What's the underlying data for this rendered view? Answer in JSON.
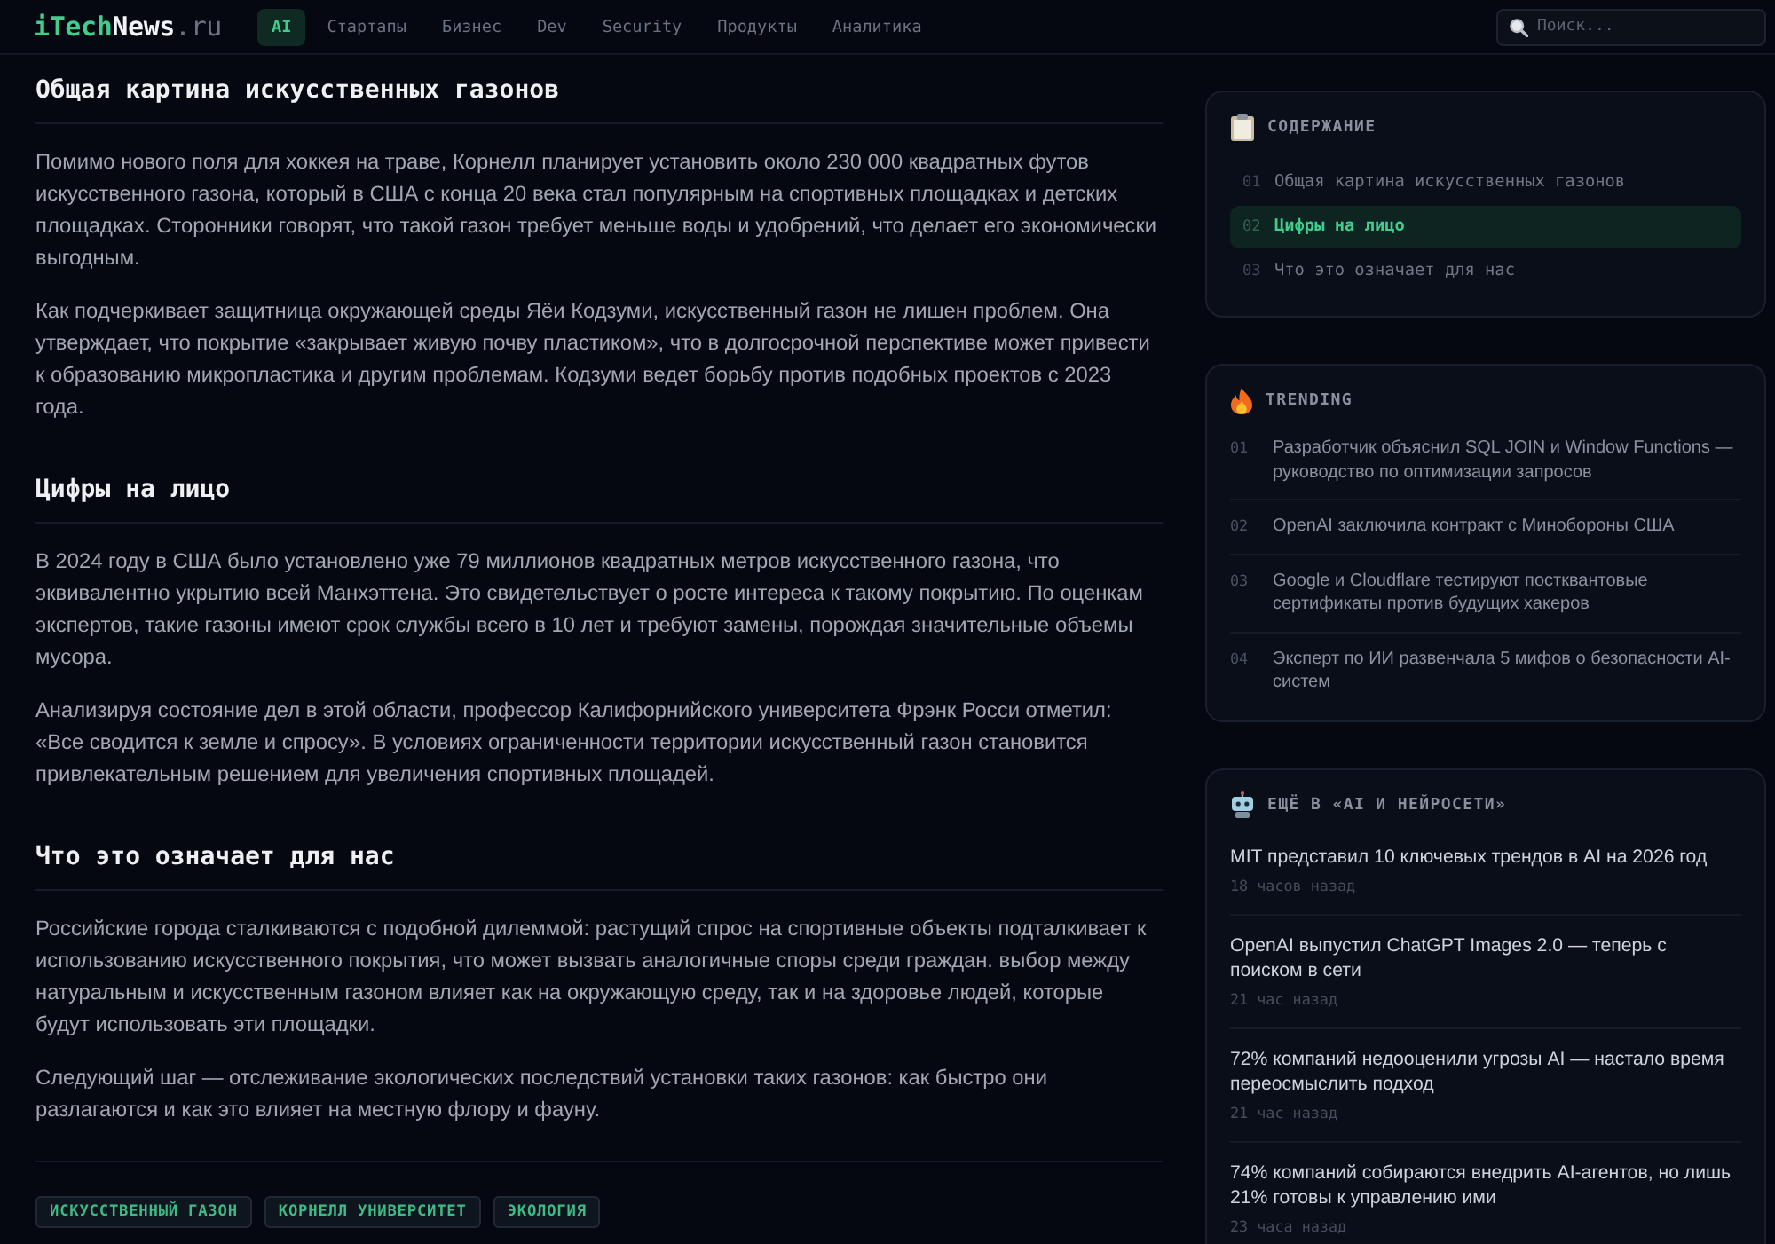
{
  "header": {
    "logo": {
      "parts": [
        "iTech",
        "News",
        ".ru"
      ]
    },
    "nav": [
      {
        "label": "AI",
        "selected": true
      },
      {
        "label": "Стартапы",
        "selected": false
      },
      {
        "label": "Бизнес",
        "selected": false
      },
      {
        "label": "Dev",
        "selected": false
      },
      {
        "label": "Security",
        "selected": false
      },
      {
        "label": "Продукты",
        "selected": false
      },
      {
        "label": "Аналитика",
        "selected": false
      }
    ],
    "search": {
      "placeholder": "Поиск..."
    }
  },
  "article": {
    "sections": [
      {
        "heading": "Общая картина искусственных газонов",
        "paragraphs": [
          "Помимо нового поля для хоккея на траве, Корнелл планирует установить около 230 000 квадратных футов искусственного газона, который в США с конца 20 века стал популярным на спортивных площадках и детских площадках. Сторонники говорят, что такой газон требует меньше воды и удобрений, что делает его экономически выгодным.",
          "Как подчеркивает защитница окружающей среды Яёи Кодзуми, искусственный газон не лишен проблем. Она утверждает, что покрытие «закрывает живую почву пластиком», что в долгосрочной перспективе может привести к образованию микропластика и другим проблемам. Кодзуми ведет борьбу против подобных проектов с 2023 года."
        ]
      },
      {
        "heading": "Цифры на лицо",
        "paragraphs": [
          "В 2024 году в США было установлено уже 79 миллионов квадратных метров искусственного газона, что эквивалентно укрытию всей Манхэттена. Это свидетельствует о росте интереса к такому покрытию. По оценкам экспертов, такие газоны имеют срок службы всего в 10 лет и требуют замены, порождая значительные объемы мусора.",
          "Анализируя состояние дел в этой области, профессор Калифорнийского университета Фрэнк Росси отметил: «Все сводится к земле и спросу». В условиях ограниченности территории искусственный газон становится привлекательным решением для увеличения спортивных площадей."
        ]
      },
      {
        "heading": "Что это означает для нас",
        "paragraphs": [
          "Российские города сталкиваются с подобной дилеммой: растущий спрос на спортивные объекты подталкивает к использованию искусственного покрытия, что может вызвать аналогичные споры среди граждан. выбор между натуральным и искусственным газоном влияет как на окружающую среду, так и на здоровье людей, которые будут использовать эти площадки.",
          "Следующий шаг — отслеживание экологических последствий установки таких газонов: как быстро они разлагаются и как это влияет на местную флору и фауну."
        ]
      }
    ],
    "tags": [
      "ИСКУССТВЕННЫЙ ГАЗОН",
      "КОРНЕЛЛ УНИВЕРСИТЕТ",
      "ЭКОЛОГИЯ"
    ]
  },
  "sidebar": {
    "contents": {
      "title": "СОДЕРЖАНИЕ",
      "items": [
        {
          "number": "01",
          "label": "Общая картина искусственных газонов",
          "selected": false
        },
        {
          "number": "02",
          "label": "Цифры на лицо",
          "selected": true
        },
        {
          "number": "03",
          "label": "Что это означает для нас",
          "selected": false
        }
      ]
    },
    "trending": {
      "title": "TRENDING",
      "items": [
        {
          "number": "01",
          "title": "Разработчик объяснил SQL JOIN и Window Functions — руководство по оптимизации запросов"
        },
        {
          "number": "02",
          "title": "OpenAI заключила контракт с Минобороны США"
        },
        {
          "number": "03",
          "title": "Google и Cloudflare тестируют постквантовые сертификаты против будущих хакеров"
        },
        {
          "number": "04",
          "title": "Эксперт по ИИ развенчала 5 мифов о безопасности AI-систем"
        }
      ]
    },
    "more": {
      "title": "ЕЩЁ В «AI И НЕЙРОСЕТИ»",
      "items": [
        {
          "title": "MIT представил 10 ключевых трендов в AI на 2026 год",
          "time": "18 часов назад"
        },
        {
          "title": "OpenAI выпустил ChatGPT Images 2.0 — теперь с поиском в сети",
          "time": "21 час назад"
        },
        {
          "title": "72% компаний недооценили угрозы AI — настало время переосмыслить подход",
          "time": "21 час назад"
        },
        {
          "title": "74% компаний собираются внедрить AI-агентов, но лишь 21% готовы к управлению ими",
          "time": "23 часа назад"
        }
      ]
    }
  }
}
